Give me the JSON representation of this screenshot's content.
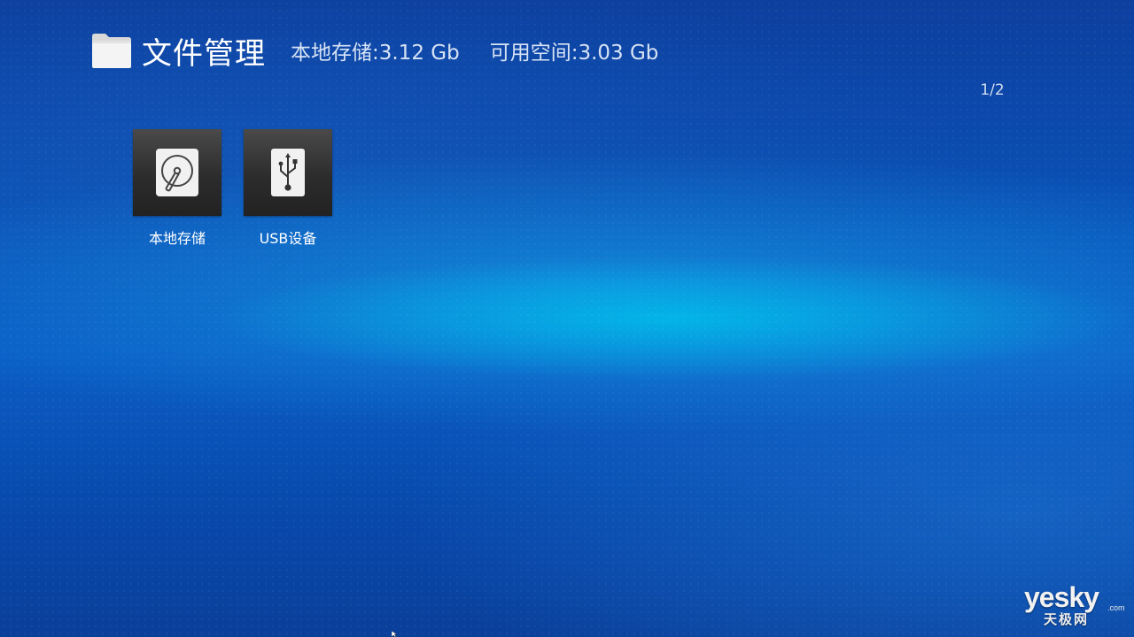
{
  "header": {
    "icon": "folder-icon",
    "title": "文件管理",
    "local_storage": "本地存储:3.12 Gb",
    "available_space": "可用空间:3.03 Gb"
  },
  "page_indicator": "1/2",
  "tiles": [
    {
      "label": "本地存储",
      "icon": "hard-disk-icon"
    },
    {
      "label": "USB设备",
      "icon": "usb-icon"
    }
  ],
  "watermark": {
    "main": "yesky",
    "dotcom": ".com",
    "sub": "天极网"
  },
  "colors": {
    "background": "#0b5ec6",
    "tile": "#2e2e2e",
    "text": "#ffffff"
  }
}
